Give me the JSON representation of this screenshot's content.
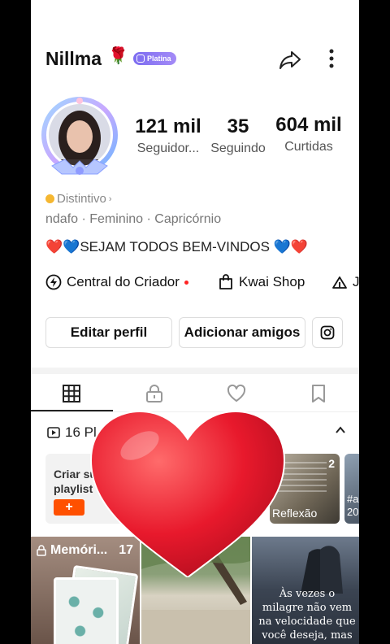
{
  "profile": {
    "username": "Nillma",
    "username_emoji": "🌹",
    "level_badge": "Platina",
    "badge_link": "Distintivo",
    "info_line": "ndafo · Feminino · Capricórnio",
    "bio": "❤️💙SEJAM TODOS BEM-VINDOS  💙❤️"
  },
  "stats": [
    {
      "value": "121 mil",
      "label": "Seguidor..."
    },
    {
      "value": "35",
      "label": "Seguindo"
    },
    {
      "value": "604 mil",
      "label": "Curtidas"
    }
  ],
  "links": {
    "creator_center": "Central do Criador",
    "kwai_shop": "Kwai Shop",
    "third_partial": "J"
  },
  "buttons": {
    "edit_profile": "Editar perfil",
    "add_friends": "Adicionar amigos"
  },
  "tabs": {
    "icons": [
      "grid-icon",
      "lock-icon",
      "heart-icon",
      "bookmark-icon"
    ],
    "active_index": 0
  },
  "playlists": {
    "header": "16 Pl",
    "create_label": "Criar su\nplaylist",
    "create_plus": "+",
    "card1_label": "Reflexão",
    "card1_count": "2",
    "card2_label": "#a\n20"
  },
  "grid": {
    "item1_title": "Memóri...",
    "item1_count": "17",
    "item3_text": "Às vezes o milagre não vem na velocidade que você deseja, mas"
  },
  "colors": {
    "accent": "#ff5000",
    "badge": "#8b76f3",
    "heart": "#e8192c"
  }
}
